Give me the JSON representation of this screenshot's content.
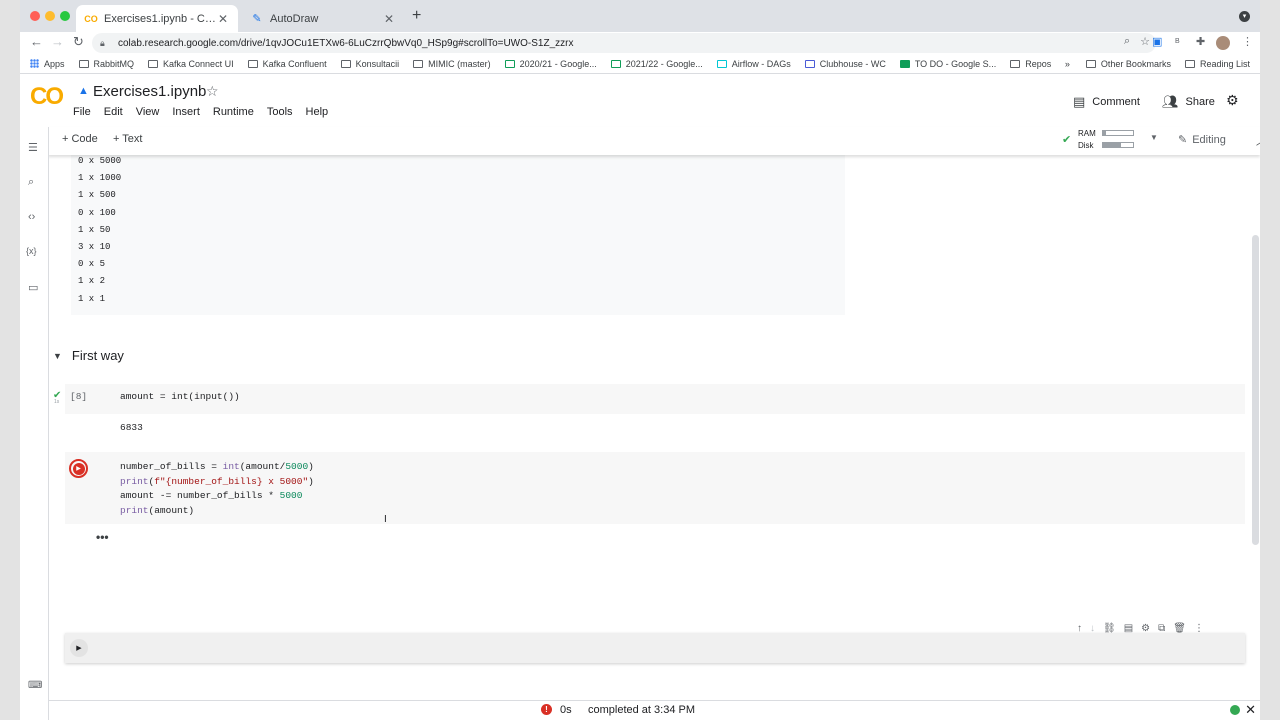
{
  "browser": {
    "tabs": [
      {
        "title": "Exercises1.ipynb - Colaboratory",
        "favicon": "co-favicon"
      },
      {
        "title": "AutoDraw",
        "favicon": "autodraw-favicon"
      }
    ],
    "url": "colab.research.google.com/drive/1qvJOCu1ETXw6-6LuCzrrQbwVq0_HSp9g#scrollTo=UWO-S1Z_zzrx",
    "bookmarks": [
      "Apps",
      "RabbitMQ",
      "Kafka Connect UI",
      "Kafka Confluent",
      "Konsultacii",
      "MIMIC (master)",
      "2020/21 - Google...",
      "2021/22 - Google...",
      "Airflow - DAGs",
      "Clubhouse - WC",
      "TO DO - Google S...",
      "Repos"
    ],
    "bookmarks_overflow": "»",
    "other_bookmarks": "Other Bookmarks",
    "reading_list": "Reading List"
  },
  "colab": {
    "logo": "CO",
    "notebook_title": "Exercises1.ipynb",
    "menu": [
      "File",
      "Edit",
      "View",
      "Insert",
      "Runtime",
      "Tools",
      "Help"
    ],
    "comment": "Comment",
    "share": "Share",
    "add_code": "+ Code",
    "add_text": "+ Text",
    "ram_label": "RAM",
    "disk_label": "Disk",
    "ram_usage": 0.1,
    "disk_usage": 0.6,
    "editing": "Editing"
  },
  "notebook": {
    "prev_output": [
      "0 x 5000",
      "1 x 1000",
      "1 x 500",
      "0 x 100",
      "1 x 50",
      "3 x 10",
      "0 x 5",
      "1 x 2",
      "1 x 1"
    ],
    "section_title": "First way",
    "cell1": {
      "exec": "[8]",
      "code": "amount = int(input())",
      "output": "6833"
    },
    "cell2_lines": [
      "number_of_bills = int(amount/5000)",
      "print(f\"{number_of_bills} x 5000\")",
      "amount -= number_of_bills * 5000",
      "print(amount)"
    ],
    "running_dots": "•••"
  },
  "status": {
    "duration": "0s",
    "message": "completed at 3:34 PM",
    "error_icon": "!"
  }
}
